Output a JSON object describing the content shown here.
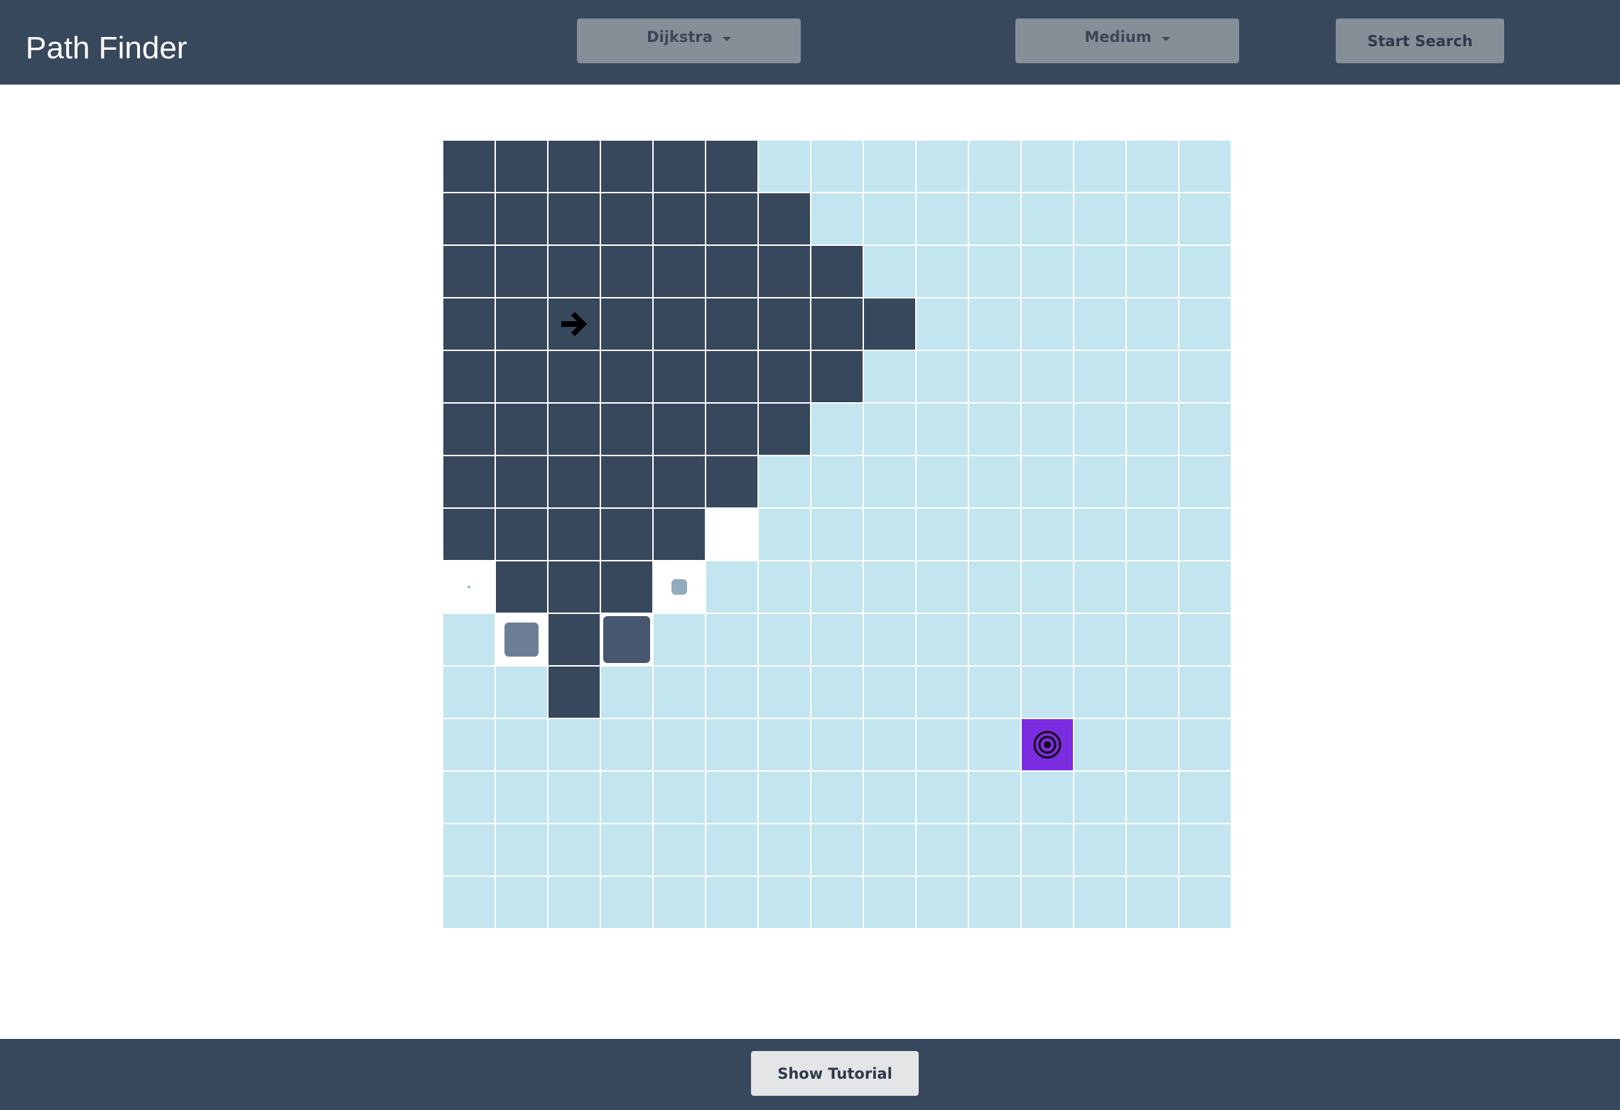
{
  "header": {
    "title": "Path Finder",
    "algorithm_select": {
      "selected": "Dijkstra"
    },
    "speed_select": {
      "selected": "Medium"
    },
    "start_button": "Start Search"
  },
  "footer": {
    "tutorial_button": "Show Tutorial"
  },
  "colors": {
    "header_bg": "#37475c",
    "unvisited": "#c2e5f0",
    "visited": "#37475c",
    "frontier": "#ffffff",
    "target": "#7b2be0"
  },
  "grid": {
    "rows": 15,
    "cols": 15,
    "legend": {
      "V": "visited",
      ".": "unvisited",
      "W": "frontier",
      "a": "frontier-animating-tiny",
      "b": "frontier-animating-small",
      "c": "frontier-animating-medium",
      "d": "visited-animating-large",
      "S": "start-node",
      "T": "target-node"
    },
    "cells": [
      "VVVVVV.........",
      "VVVVVVV........",
      "VVVVVVVV.......",
      "VVSVVVVVV......",
      "VVVVVVVV.......",
      "VVVVVVV........",
      "VVVVVV.........",
      "VVVVVW.........",
      "aVVVb..........",
      ".cVd...........",
      "..V............",
      "...........T...",
      "...............",
      "...............",
      "..............."
    ],
    "start_icon": "right-arrow-icon",
    "target_icon": "target-icon"
  }
}
